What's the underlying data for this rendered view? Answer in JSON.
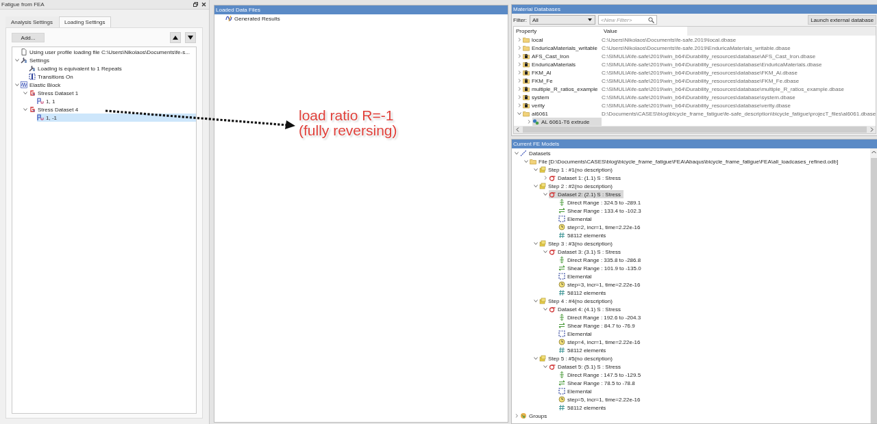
{
  "left_panel": {
    "title": "Fatigue from FEA",
    "tabs": [
      {
        "label": "Analysis Settings",
        "selected": false
      },
      {
        "label": "Loading Settings",
        "selected": true
      }
    ],
    "add_button": "Add...",
    "tree": [
      {
        "label": "Using user profile loading file C:\\Users\\Nikolaos\\Documents\\fe-s...",
        "kind": "document",
        "selected": false
      },
      {
        "label": "Settings",
        "kind": "wrench",
        "expanded": true,
        "selected": false,
        "children": [
          {
            "label": "Loading is equivalent to 1 Repeats",
            "kind": "wrench",
            "selected": false
          },
          {
            "label": "Transitions On",
            "kind": "transitions",
            "selected": false
          }
        ]
      },
      {
        "label": "Elastic Block",
        "kind": "block",
        "expanded": true,
        "selected": false,
        "children": [
          {
            "label": "Stress Dataset 1",
            "kind": "dataset",
            "expanded": true,
            "selected": false,
            "children": [
              {
                "label": "1, 1",
                "kind": "pair",
                "selected": false
              }
            ]
          },
          {
            "label": "Stress Dataset 4",
            "kind": "dataset",
            "expanded": true,
            "selected": false,
            "children": [
              {
                "label": "1, -1",
                "kind": "pair",
                "selected": true
              }
            ]
          }
        ]
      }
    ]
  },
  "loaded_data": {
    "title": "Loaded Data Files",
    "items": [
      {
        "label": "Generated Results",
        "kind": "generated",
        "selected": false
      }
    ]
  },
  "annotation": {
    "lines": [
      "load ratio R=-1",
      "(fully reversing)"
    ]
  },
  "materials": {
    "title": "Material Databases",
    "filter_label": "Filter:",
    "filter_value": "All",
    "search_placeholder": "<New Filter>",
    "launch_button": "Launch external database",
    "columns": [
      "Property",
      "Value"
    ],
    "rows": [
      {
        "label": "local",
        "value": "C:\\Users\\Nikolaos\\Documents\\fe-safe.2019\\local.dbase",
        "kind": "folder",
        "expanded": false,
        "selected": false
      },
      {
        "label": "EnduricaMaterials_writable",
        "value": "C:\\Users\\Nikolaos\\Documents\\fe-safe.2019\\EnduricaMaterials_writable.dbase",
        "kind": "folder",
        "expanded": false,
        "selected": false
      },
      {
        "label": "AFS_Cast_Iron",
        "value": "C:\\SIMULIA\\fe-safe\\2019\\win_b64\\Durability_resources\\database\\AFS_Cast_Iron.dbase",
        "kind": "locked",
        "expanded": false,
        "selected": false
      },
      {
        "label": "EnduricaMaterials",
        "value": "C:\\SIMULIA\\fe-safe\\2019\\win_b64\\Durability_resources\\database\\EnduricaMaterials.dbase",
        "kind": "locked",
        "expanded": false,
        "selected": false
      },
      {
        "label": "FKM_Al",
        "value": "C:\\SIMULIA\\fe-safe\\2019\\win_b64\\Durability_resources\\database\\FKM_Al.dbase",
        "kind": "locked",
        "expanded": false,
        "selected": false
      },
      {
        "label": "FKM_Fe",
        "value": "C:\\SIMULIA\\fe-safe\\2019\\win_b64\\Durability_resources\\database\\FKM_Fe.dbase",
        "kind": "locked",
        "expanded": false,
        "selected": false
      },
      {
        "label": "multiple_R_ratios_example",
        "value": "C:\\SIMULIA\\fe-safe\\2019\\win_b64\\Durability_resources\\database\\multiple_R_ratios_example.dbase",
        "kind": "locked",
        "expanded": false,
        "selected": false
      },
      {
        "label": "system",
        "value": "C:\\SIMULIA\\fe-safe\\2019\\win_b64\\Durability_resources\\database\\system.dbase",
        "kind": "locked",
        "expanded": false,
        "selected": false
      },
      {
        "label": "verity",
        "value": "C:\\SIMULIA\\fe-safe\\2019\\win_b64\\Durability_resources\\database\\verity.dbase",
        "kind": "locked",
        "expanded": false,
        "selected": false
      },
      {
        "label": "al6061",
        "value": "D:\\Documents\\CASES\\blog\\bicycle_frame_fatigue\\fe-safe_description\\bicycle_fatigue\\projecT_files\\al6061.dbase",
        "kind": "folder",
        "expanded": true,
        "selected": false,
        "children": [
          {
            "label": "AL 6061-T6 extrude",
            "kind": "material",
            "expanded": false,
            "selected": true
          }
        ]
      }
    ]
  },
  "fe_models": {
    "title": "Current FE Models",
    "tree": [
      {
        "label": "Datasets",
        "kind": "datasets",
        "expanded": true,
        "selected": false,
        "children": [
          {
            "label": "File [D:\\Documents\\CASES\\blog\\bicycle_frame_fatigue\\FEA\\Abaqus\\bicycle_frame_fatigue\\FEA\\all_loadcases_refined.odb]",
            "kind": "folder",
            "expanded": true,
            "selected": false,
            "children": [
              {
                "label": "Step 1 : #1(no description)",
                "kind": "step",
                "expanded": true,
                "selected": false,
                "children": [
                  {
                    "label": "Dataset 1: (1.1) S :  Stress",
                    "kind": "sigma",
                    "expanded": false,
                    "selected": false
                  }
                ]
              },
              {
                "label": "Step 2 : #2(no description)",
                "kind": "step",
                "expanded": true,
                "selected": false,
                "children": [
                  {
                    "label": "Dataset 2: (2.1) S :  Stress",
                    "kind": "sigma",
                    "expanded": true,
                    "selected": true,
                    "children": [
                      {
                        "label": "Direct Range : 324.5 to -289.1",
                        "kind": "direct",
                        "selected": false
                      },
                      {
                        "label": "Shear Range : 133.4 to -102.3",
                        "kind": "shear",
                        "selected": false
                      },
                      {
                        "label": "Elemental",
                        "kind": "elemental",
                        "selected": false
                      },
                      {
                        "label": "step=2, incr=1, time=2.22e-16",
                        "kind": "clock",
                        "selected": false
                      },
                      {
                        "label": "58112 elements",
                        "kind": "hash",
                        "selected": false
                      }
                    ]
                  }
                ]
              },
              {
                "label": "Step 3 : #3(no description)",
                "kind": "step",
                "expanded": true,
                "selected": false,
                "children": [
                  {
                    "label": "Dataset 3: (3.1) S :  Stress",
                    "kind": "sigma",
                    "expanded": true,
                    "selected": false,
                    "children": [
                      {
                        "label": "Direct Range : 335.8 to -286.8",
                        "kind": "direct",
                        "selected": false
                      },
                      {
                        "label": "Shear Range : 101.9 to -135.0",
                        "kind": "shear",
                        "selected": false
                      },
                      {
                        "label": "Elemental",
                        "kind": "elemental",
                        "selected": false
                      },
                      {
                        "label": "step=3, incr=1, time=2.22e-16",
                        "kind": "clock",
                        "selected": false
                      },
                      {
                        "label": "58112 elements",
                        "kind": "hash",
                        "selected": false
                      }
                    ]
                  }
                ]
              },
              {
                "label": "Step 4 : #4(no description)",
                "kind": "step",
                "expanded": true,
                "selected": false,
                "children": [
                  {
                    "label": "Dataset 4: (4.1) S :  Stress",
                    "kind": "sigma",
                    "expanded": true,
                    "selected": false,
                    "children": [
                      {
                        "label": "Direct Range : 192.6 to -204.3",
                        "kind": "direct",
                        "selected": false
                      },
                      {
                        "label": "Shear Range : 84.7 to -76.9",
                        "kind": "shear",
                        "selected": false
                      },
                      {
                        "label": "Elemental",
                        "kind": "elemental",
                        "selected": false
                      },
                      {
                        "label": "step=4, incr=1, time=2.22e-16",
                        "kind": "clock",
                        "selected": false
                      },
                      {
                        "label": "58112 elements",
                        "kind": "hash",
                        "selected": false
                      }
                    ]
                  }
                ]
              },
              {
                "label": "Step 5 : #5(no description)",
                "kind": "step",
                "expanded": true,
                "selected": false,
                "children": [
                  {
                    "label": "Dataset 5: (5.1) S :  Stress",
                    "kind": "sigma",
                    "expanded": true,
                    "selected": false,
                    "children": [
                      {
                        "label": "Direct Range : 147.5 to -129.5",
                        "kind": "direct",
                        "selected": false
                      },
                      {
                        "label": "Shear Range : 78.5 to -78.8",
                        "kind": "shear",
                        "selected": false
                      },
                      {
                        "label": "Elemental",
                        "kind": "elemental",
                        "selected": false
                      },
                      {
                        "label": "step=5, incr=1, time=2.22e-16",
                        "kind": "clock",
                        "selected": false
                      },
                      {
                        "label": "58112 elements",
                        "kind": "hash",
                        "selected": false
                      }
                    ]
                  }
                ]
              }
            ]
          }
        ]
      },
      {
        "label": "Groups",
        "kind": "groups",
        "expanded": false,
        "selected": false
      }
    ]
  }
}
